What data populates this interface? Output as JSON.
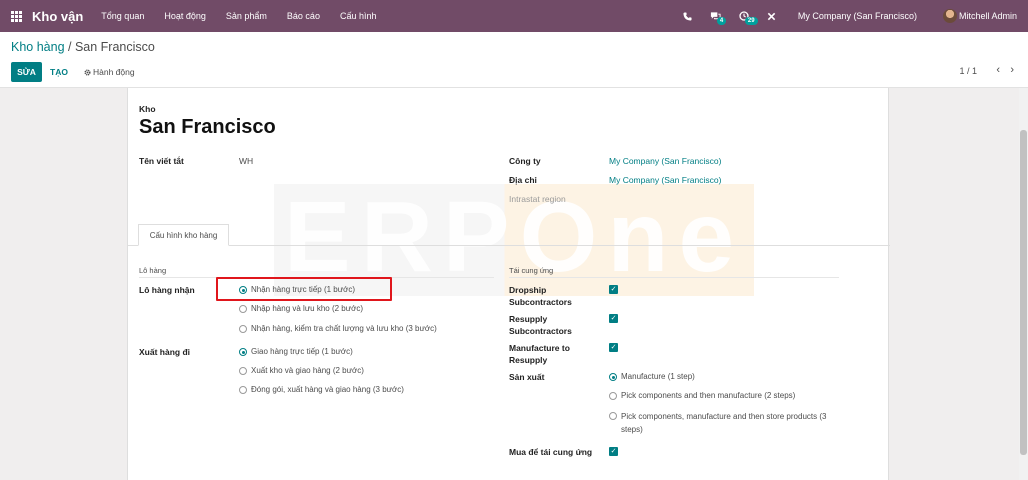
{
  "navbar": {
    "app_name": "Kho vận",
    "menu": [
      "Tổng quan",
      "Hoạt động",
      "Sản phẩm",
      "Báo cáo",
      "Cấu hình"
    ],
    "messages_badge": "4",
    "activities_badge": "29",
    "company": "My Company (San Francisco)",
    "user": "Mitchell Admin"
  },
  "control": {
    "breadcrumb_parent": "Kho hàng",
    "breadcrumb_sep": " / ",
    "breadcrumb_current": "San Francisco",
    "edit_label": "SỬA",
    "create_label": "TẠO",
    "action_label": "Hành động",
    "pager": "1 / 1"
  },
  "watermark": "ERPOne",
  "record": {
    "kind_label": "Kho",
    "name": "San Francisco",
    "short_name_label": "Tên viết tắt",
    "short_name": "WH",
    "company_label": "Công ty",
    "company": "My Company (San Francisco)",
    "address_label": "Địa chỉ",
    "address": "My Company (San Francisco)",
    "intrastat_label": "Intrastat region"
  },
  "tab_label": "Cấu hình kho hàng",
  "shipments": {
    "group_title": "Lô hàng",
    "incoming_label": "Lô hàng nhận",
    "incoming_options": [
      "Nhận hàng trực tiếp (1 bước)",
      "Nhập hàng và lưu kho (2 bước)",
      "Nhận hàng, kiểm tra chất lượng và lưu kho (3 bước)"
    ],
    "outgoing_label": "Xuất hàng đi",
    "outgoing_options": [
      "Giao hàng trực tiếp (1 bước)",
      "Xuất kho và giao hàng (2 bước)",
      "Đóng gói, xuất hàng và giao hàng (3 bước)"
    ]
  },
  "resupply": {
    "group_title": "Tái cung ứng",
    "dropship_label_1": "Dropship",
    "dropship_label_2": "Subcontractors",
    "resupply_label_1": "Resupply",
    "resupply_label_2": "Subcontractors",
    "mto_label_1": "Manufacture to",
    "mto_label_2": "Resupply",
    "manufacture_label": "Sản xuất",
    "manufacture_options": [
      "Manufacture (1 step)",
      "Pick components and then manufacture (2 steps)",
      "Pick components, manufacture and then store products (3 steps)"
    ],
    "buy_label": "Mua để tái cung ứng"
  },
  "colors": {
    "navbar": "#714b67",
    "primary": "#017e84",
    "highlight": "#e0161c"
  }
}
